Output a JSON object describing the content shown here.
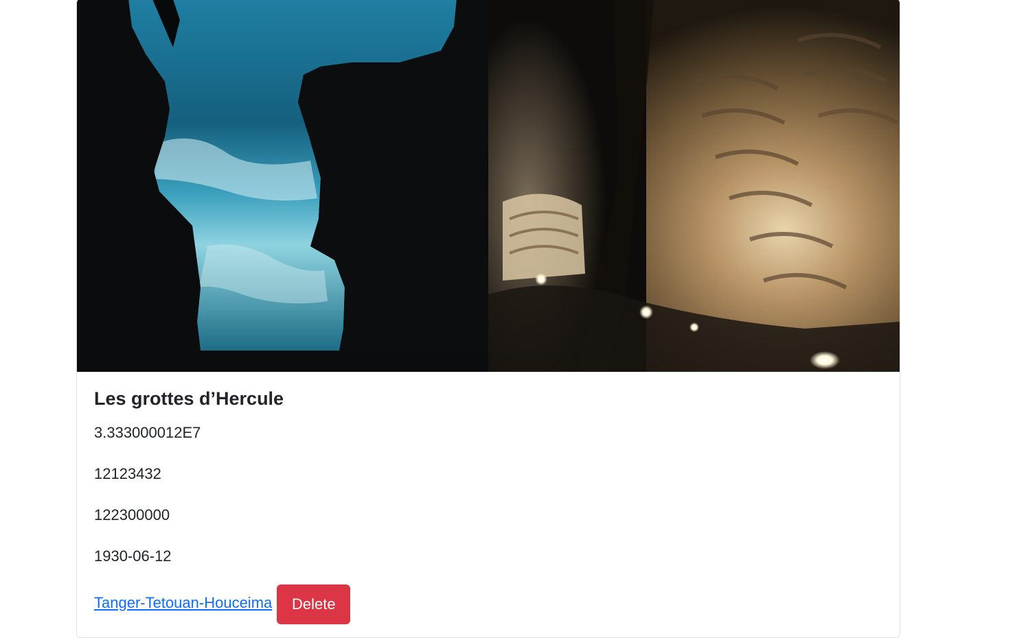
{
  "card": {
    "image_alt": "Les grottes d’Hercule",
    "title": "Les grottes d’Hercule",
    "values": [
      "3.333000012E7",
      "12123432",
      "122300000",
      "1930-06-12"
    ],
    "region_link": "Tanger-Tetouan-Houceima",
    "delete_label": "Delete"
  },
  "colors": {
    "link": "#0d6efd",
    "danger": "#dc3545",
    "border": "#dfe1e4"
  }
}
